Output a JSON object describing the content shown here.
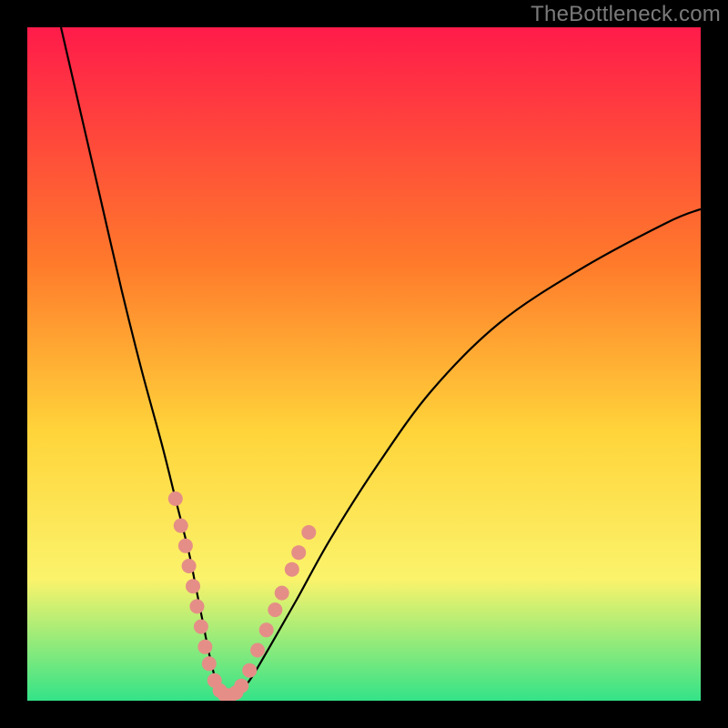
{
  "watermark": "TheBottleneck.com",
  "chart_data": {
    "type": "line",
    "title": "",
    "xlabel": "",
    "ylabel": "",
    "xlim": [
      0,
      100
    ],
    "ylim": [
      0,
      100
    ],
    "grid": false,
    "legend": null,
    "background_gradient": {
      "top": "#ff1b4a",
      "mid1": "#ff7a2b",
      "mid2": "#ffd43a",
      "mid3": "#fbf36b",
      "bottom": "#34e388"
    },
    "series": [
      {
        "name": "bottleneck-curve",
        "color": "#000000",
        "x": [
          5,
          8,
          11,
          14,
          17,
          20,
          22,
          24,
          25,
          26,
          27,
          28,
          29,
          30,
          31,
          33,
          36,
          40,
          45,
          52,
          60,
          70,
          82,
          95,
          100
        ],
        "y": [
          100,
          87,
          74,
          61,
          49,
          38,
          30,
          22,
          17,
          12,
          7,
          3,
          1,
          0.5,
          1,
          3,
          8,
          15,
          24,
          35,
          46,
          56,
          64,
          71,
          73
        ]
      }
    ],
    "markers": {
      "name": "highlight-dots",
      "color": "#e58e87",
      "radius_px": 8,
      "points": [
        {
          "x": 22.0,
          "y": 30
        },
        {
          "x": 22.8,
          "y": 26
        },
        {
          "x": 23.5,
          "y": 23
        },
        {
          "x": 24.0,
          "y": 20
        },
        {
          "x": 24.6,
          "y": 17
        },
        {
          "x": 25.2,
          "y": 14
        },
        {
          "x": 25.8,
          "y": 11
        },
        {
          "x": 26.4,
          "y": 8
        },
        {
          "x": 27.0,
          "y": 5.5
        },
        {
          "x": 27.8,
          "y": 3
        },
        {
          "x": 28.6,
          "y": 1.5
        },
        {
          "x": 29.3,
          "y": 0.9
        },
        {
          "x": 30.2,
          "y": 0.8
        },
        {
          "x": 31.0,
          "y": 1.2
        },
        {
          "x": 31.8,
          "y": 2.2
        },
        {
          "x": 33.0,
          "y": 4.5
        },
        {
          "x": 34.2,
          "y": 7.5
        },
        {
          "x": 35.5,
          "y": 10.5
        },
        {
          "x": 36.8,
          "y": 13.5
        },
        {
          "x": 37.8,
          "y": 16
        },
        {
          "x": 39.3,
          "y": 19.5
        },
        {
          "x": 40.3,
          "y": 22
        },
        {
          "x": 41.8,
          "y": 25
        }
      ]
    }
  }
}
